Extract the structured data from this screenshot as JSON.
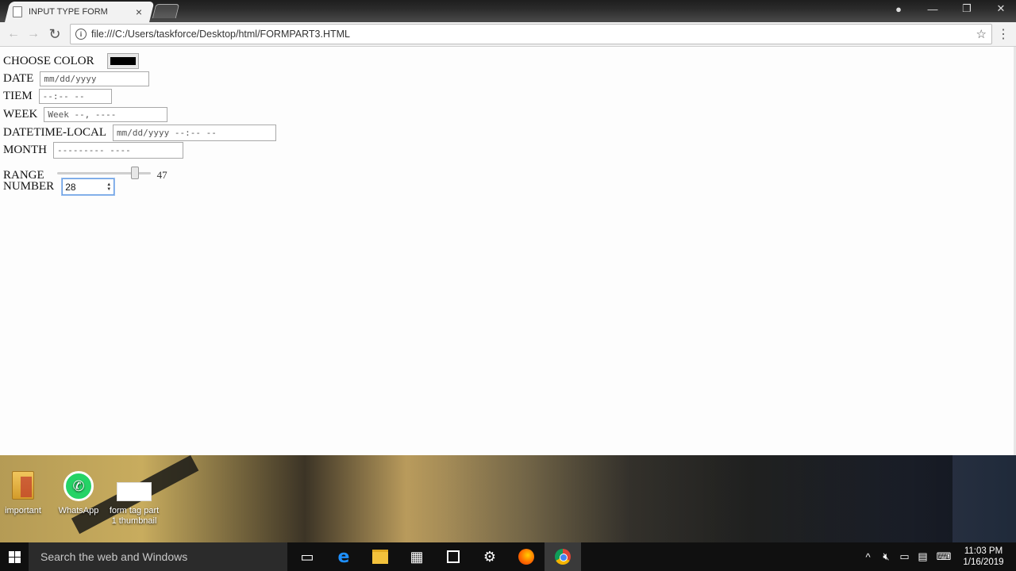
{
  "browser": {
    "tab_title": "INPUT TYPE FORM",
    "tab_close": "×",
    "url": "file:///C:/Users/taskforce/Desktop/html/FORMPART3.HTML"
  },
  "form": {
    "color_label": "CHOOSE COLOR",
    "color_value": "#000000",
    "date_label": "DATE",
    "date_placeholder": "mm/dd/yyyy",
    "time_label": "TIEM",
    "time_placeholder": "--:-- --",
    "week_label": "WEEK",
    "week_placeholder": "Week --, ----",
    "datetime_label": "DATETIME-LOCAL",
    "datetime_placeholder": "mm/dd/yyyy --:-- --",
    "month_label": "MONTH",
    "month_placeholder": "--------- ----",
    "range_label": "RANGE",
    "range_value": 47,
    "range_fraction": 0.85,
    "number_label": "NUMBER",
    "number_value": "28"
  },
  "desktop": {
    "icons": [
      {
        "label": "important"
      },
      {
        "label": "WhatsApp"
      },
      {
        "label": "form tag part 1 thumbnail"
      }
    ]
  },
  "taskbar": {
    "search_placeholder": "Search the web and Windows",
    "time": "11:03 PM",
    "date": "1/16/2019"
  }
}
